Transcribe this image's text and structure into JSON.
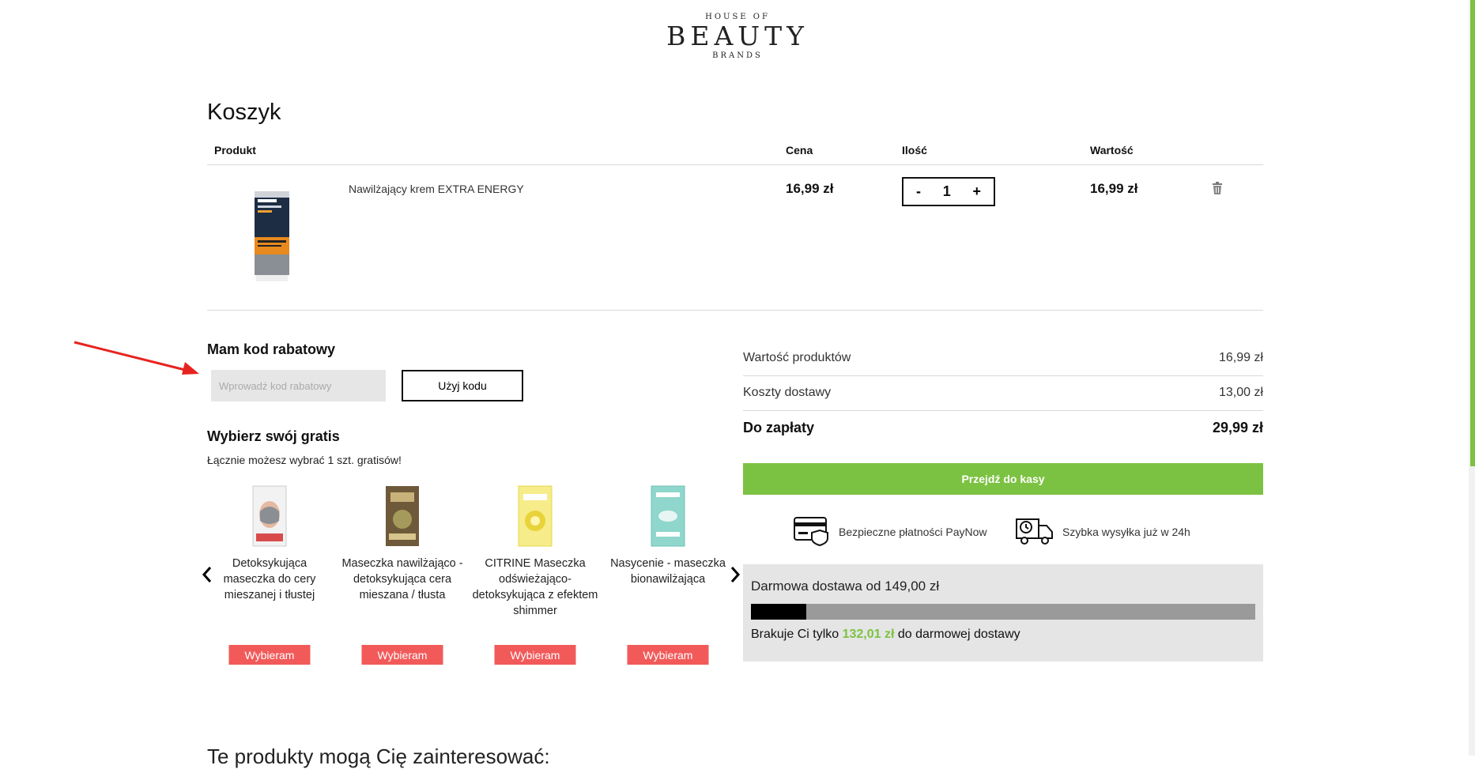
{
  "logo": {
    "top": "HOUSE OF",
    "main": "BEAUTY",
    "bottom": "BRANDS"
  },
  "page_title": "Koszyk",
  "table_headers": {
    "product": "Produkt",
    "price": "Cena",
    "qty": "Ilość",
    "value": "Wartość"
  },
  "cart_item": {
    "name": "Nawilżający krem EXTRA ENERGY",
    "price": "16,99 zł",
    "qty": "1",
    "value": "16,99 zł",
    "minus": "-",
    "plus": "+"
  },
  "discount": {
    "title": "Mam kod rabatowy",
    "placeholder": "Wprowadź kod rabatowy",
    "button": "Użyj kodu"
  },
  "gifts": {
    "title": "Wybierz swój gratis",
    "note": "Łącznie możesz wybrać 1 szt. gratisów!",
    "button": "Wybieram",
    "items": [
      {
        "name": "Detoksykująca maseczka do cery mieszanej i tłustej"
      },
      {
        "name": "Maseczka nawilżająco - detoksykująca cera mieszana / tłusta"
      },
      {
        "name": "CITRINE Maseczka odświeżająco-detoksykująca z efektem shimmer"
      },
      {
        "name": "Nasycenie - maseczka bionawilżająca"
      }
    ]
  },
  "summary": {
    "products_label": "Wartość produktów",
    "products_value": "16,99 zł",
    "shipping_label": "Koszty dostawy",
    "shipping_value": "13,00 zł",
    "total_label": "Do zapłaty",
    "total_value": "29,99 zł",
    "checkout": "Przejdź do kasy"
  },
  "features": {
    "payment": "Bezpieczne płatności PayNow",
    "shipping": "Szybka wysyłka już w 24h"
  },
  "free_shipping": {
    "title": "Darmowa dostawa od 149,00 zł",
    "msg_before": "Brakuje Ci tylko",
    "amount": "132,01 zł",
    "msg_after": "do darmowej dostawy",
    "progress_fraction": 0.11
  },
  "bottom_title": "Te produkty mogą Cię zainteresować:"
}
